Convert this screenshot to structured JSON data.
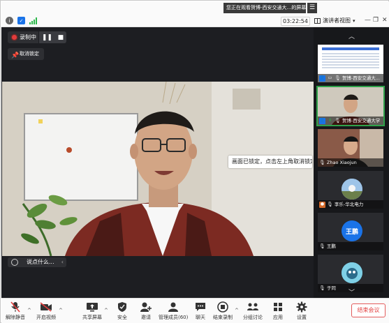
{
  "topbar": {
    "banner_text": "您正在观看贺博-西安交通大...的屏幕",
    "banner_button": "☰",
    "timer": "03:22:54",
    "view_button_label": "演讲者视图",
    "minimize": "—",
    "restore": "❐",
    "close": "✕"
  },
  "main": {
    "recording_label": "录制中",
    "unlock_label": "取消锁定",
    "say_placeholder": "说点什么...",
    "tooltip_text": "画面已锁定，点击左上角取消锁定"
  },
  "sidebar": {
    "tiles": [
      {
        "name": "贺博-西安交通大..."
      },
      {
        "name": "贺博-西安交通大学"
      },
      {
        "name": "Zhao Xiaojun"
      },
      {
        "name": "李乐-华北电力"
      },
      {
        "name": "王鹏",
        "avatar_text": "王鹏"
      },
      {
        "name": "于同"
      }
    ]
  },
  "toolbar": {
    "unmute": "解除静音",
    "video": "开启视频",
    "share": "共享屏幕",
    "security": "安全",
    "invite": "邀请",
    "members": "管理成员(60)",
    "chat": "聊天",
    "end_record": "结束录制",
    "breakout": "分组讨论",
    "apps": "应用",
    "settings": "设置",
    "end_meeting": "结束会议"
  },
  "colors": {
    "accent_green": "#2fa24a",
    "record_red": "#e23b3b",
    "end_red": "#e24040",
    "avatar_blue": "#1a73e8"
  }
}
